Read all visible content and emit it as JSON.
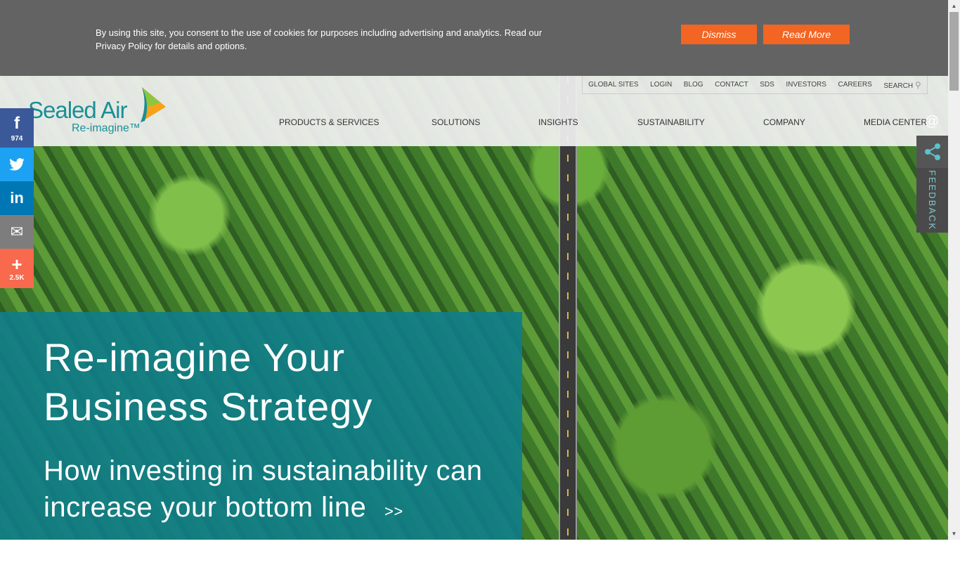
{
  "cookie": {
    "text": "By using this site, you consent to the use of cookies for purposes including advertising and analytics.  Read our Privacy Policy for details and options.",
    "dismiss": "Dismiss",
    "read_more": "Read More"
  },
  "logo": {
    "name": "Sealed Air",
    "tagline": "Re-imagine™"
  },
  "utility_nav": [
    "GLOBAL SITES",
    "LOGIN",
    "BLOG",
    "CONTACT",
    "SDS",
    "INVESTORS",
    "CAREERS",
    "SEARCH"
  ],
  "main_nav": [
    "PRODUCTS & SERVICES",
    "SOLUTIONS",
    "INSIGHTS",
    "SUSTAINABILITY",
    "COMPANY",
    "MEDIA CENTER"
  ],
  "social": {
    "facebook_count": "974",
    "more_count": "2.5K"
  },
  "hero": {
    "title": "Re-imagine Your Business Strategy",
    "subtitle": "How investing in sustainability can increase your bottom line",
    "arrow": ">>"
  },
  "feedback": "FEEDBACK",
  "colors": {
    "accent": "#f26522",
    "teal": "#1a8f97",
    "facebook": "#3b5998",
    "twitter": "#1da1f2",
    "linkedin": "#0077b5",
    "email": "#7d7d7d",
    "more": "#f8694d"
  }
}
